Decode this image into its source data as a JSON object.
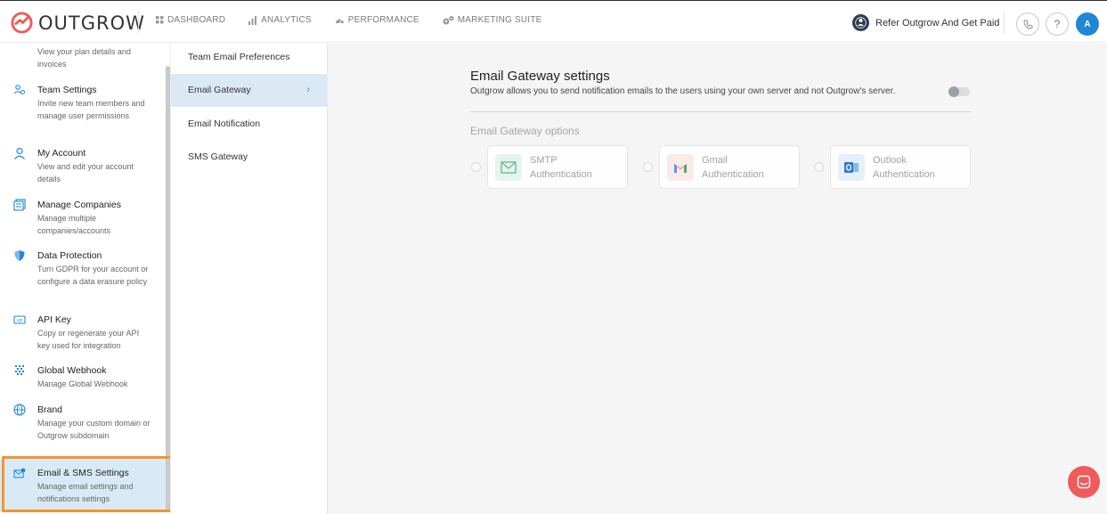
{
  "header": {
    "logo_text": "OUTGROW",
    "nav": [
      {
        "label": "DASHBOARD",
        "icon": "grid-icon"
      },
      {
        "label": "ANALYTICS",
        "icon": "bar-chart-icon"
      },
      {
        "label": "PERFORMANCE",
        "icon": "gauge-icon"
      },
      {
        "label": "MARKETING SUITE",
        "icon": "cogs-icon"
      }
    ],
    "refer_label": "Refer Outgrow And Get Paid",
    "help_label": "?",
    "avatar_initial": "A"
  },
  "sidebar": {
    "items": [
      {
        "title": "",
        "desc": "View your plan details and invoices",
        "icon": "billing-icon"
      },
      {
        "title": "Team Settings",
        "desc": "Invite new team members and manage user permissions",
        "icon": "team-icon"
      },
      {
        "title": "My Account",
        "desc": "View and edit your account details",
        "icon": "user-icon"
      },
      {
        "title": "Manage Companies",
        "desc": "Manage multiple companies/accounts",
        "icon": "companies-icon"
      },
      {
        "title": "Data Protection",
        "desc": "Turn GDPR for your account or configure a data erasure policy",
        "icon": "shield-icon"
      },
      {
        "title": "API Key",
        "desc": "Copy or regenerate your API key used for integration",
        "icon": "api-icon"
      },
      {
        "title": "Global Webhook",
        "desc": "Manage Global Webhook",
        "icon": "webhook-icon"
      },
      {
        "title": "Brand",
        "desc": "Manage your custom domain or Outgrow subdomain",
        "icon": "globe-icon"
      },
      {
        "title": "Email & SMS Settings",
        "desc": "Manage email settings and notifications settings",
        "icon": "email-settings-icon",
        "active": true
      }
    ]
  },
  "subnav": {
    "items": [
      {
        "label": "Team Email Preferences"
      },
      {
        "label": "Email Gateway",
        "active": true
      },
      {
        "label": "Email Notification"
      },
      {
        "label": "SMS Gateway"
      }
    ],
    "chevron": "›"
  },
  "main": {
    "title": "Email Gateway settings",
    "description": "Outgrow allows you to send notification emails to the users using your own server and not Outgrow's server.",
    "toggle_on": false,
    "options_title": "Email Gateway options",
    "options": [
      {
        "line1": "SMTP",
        "line2": "Authentication",
        "icon": "smtp-mail-icon"
      },
      {
        "line1": "Gmail",
        "line2": "Authentication",
        "icon": "gmail-icon"
      },
      {
        "line1": "Outlook",
        "line2": "Authentication",
        "icon": "outlook-icon"
      }
    ]
  },
  "colors": {
    "accent": "#1e88d6",
    "brand_red": "#ef5b5b",
    "highlight": "#f7942a",
    "active_bg": "#d9eaf7"
  }
}
